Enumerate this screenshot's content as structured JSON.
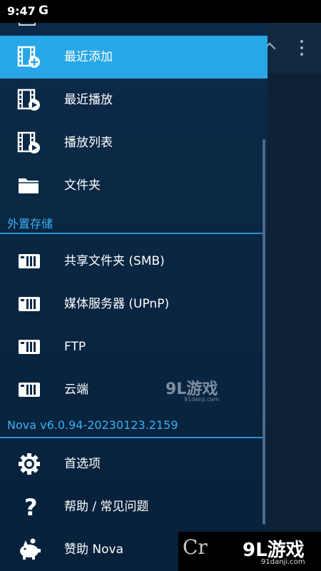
{
  "status_bar": {
    "time": "9:47",
    "account_glyph": "G"
  },
  "drawer": {
    "library_items": [
      {
        "label": "最近添加",
        "icon": "film-add-icon",
        "active": true
      },
      {
        "label": "最近播放",
        "icon": "film-play-icon",
        "active": false
      },
      {
        "label": "播放列表",
        "icon": "film-play-icon",
        "active": false
      },
      {
        "label": "文件夹",
        "icon": "folder-icon",
        "active": false
      }
    ],
    "external_section": "外置存储",
    "external_items": [
      {
        "label": "共享文件夹 (SMB)",
        "icon": "server-icon"
      },
      {
        "label": "媒体服务器 (UPnP)",
        "icon": "server-icon"
      },
      {
        "label": "FTP",
        "icon": "server-icon"
      },
      {
        "label": "云端",
        "icon": "server-icon"
      }
    ],
    "version": "Nova v6.0.94-20230123.2159",
    "footer_items": [
      {
        "label": "首选项",
        "icon": "gear-icon"
      },
      {
        "label": "帮助 / 常见问题",
        "icon": "question-icon"
      },
      {
        "label": "赞助 Nova",
        "icon": "piggy-bank-icon"
      }
    ]
  },
  "watermarks": {
    "center_brand": "9L游戏",
    "center_url": "91danji.com",
    "corner_logo": "Cr",
    "corner_brand": "9L游戏",
    "corner_url": "91danji.com"
  },
  "colors": {
    "accent": "#27a7e7",
    "section": "#3ab0f0",
    "drawer_bg": "#0c2a48"
  }
}
